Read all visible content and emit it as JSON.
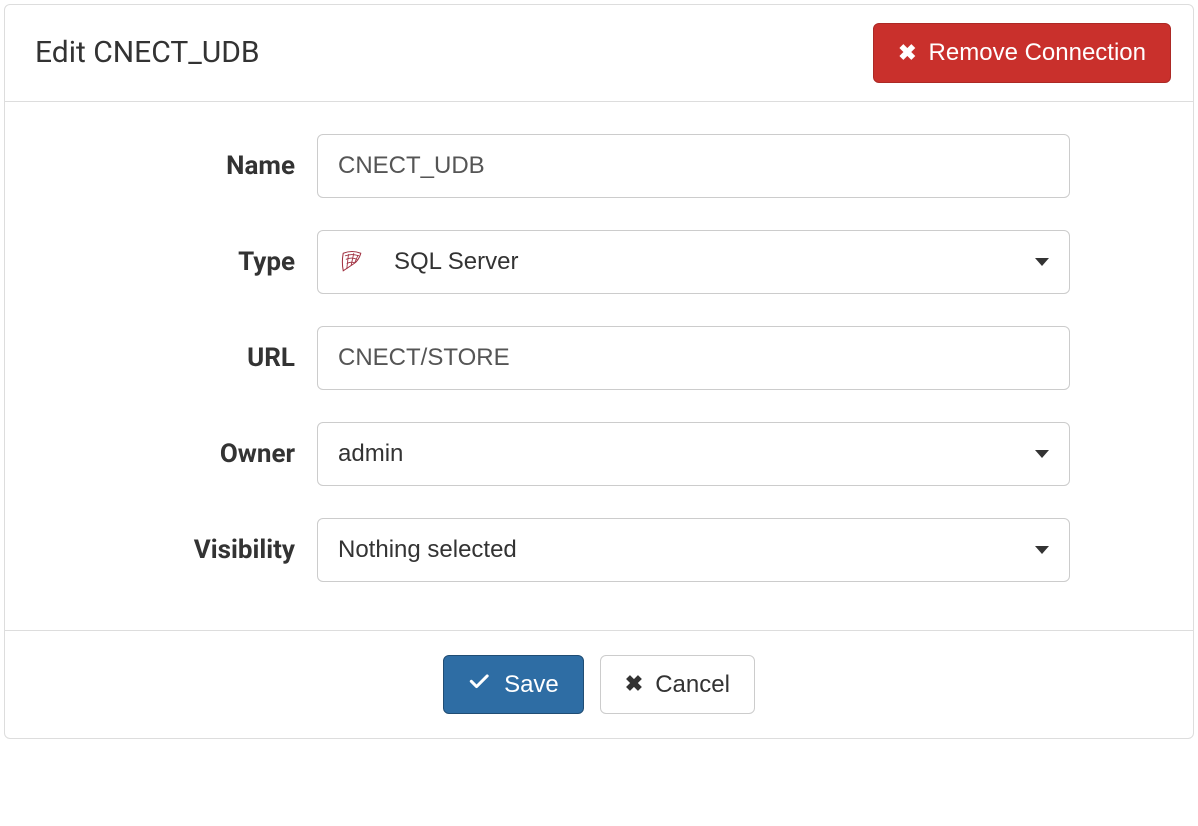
{
  "header": {
    "title": "Edit CNECT_UDB",
    "remove_label": "Remove Connection"
  },
  "form": {
    "name": {
      "label": "Name",
      "value": "CNECT_UDB"
    },
    "type": {
      "label": "Type",
      "value": "SQL Server"
    },
    "url": {
      "label": "URL",
      "value": "CNECT/STORE"
    },
    "owner": {
      "label": "Owner",
      "value": "admin"
    },
    "visibility": {
      "label": "Visibility",
      "value": "Nothing selected"
    }
  },
  "footer": {
    "save_label": "Save",
    "cancel_label": "Cancel"
  }
}
